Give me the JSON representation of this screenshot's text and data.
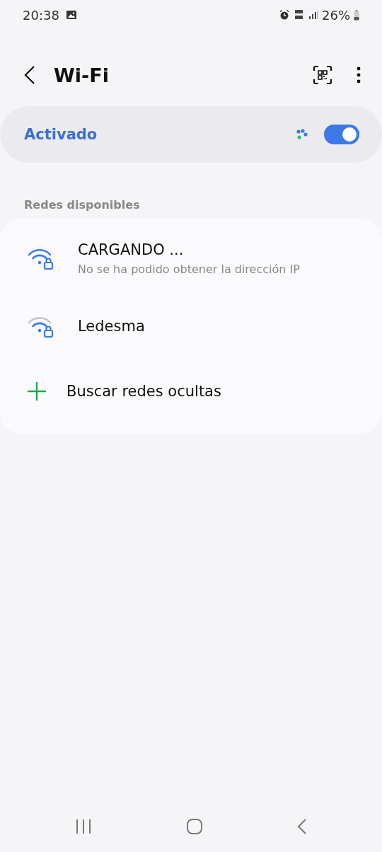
{
  "status_bar": {
    "time": "20:38",
    "battery": "26%"
  },
  "header": {
    "title": "Wi-Fi"
  },
  "master_switch": {
    "label": "Activado",
    "on": true
  },
  "section": {
    "title": "Redes disponibles"
  },
  "networks": [
    {
      "name": "CARGANDO ...",
      "status": "No se ha podido obtener la dirección IP",
      "signal_full": true,
      "locked": true
    },
    {
      "name": "Ledesma",
      "signal_full": false,
      "locked": true
    }
  ],
  "add_network": {
    "label": "Buscar redes ocultas"
  }
}
